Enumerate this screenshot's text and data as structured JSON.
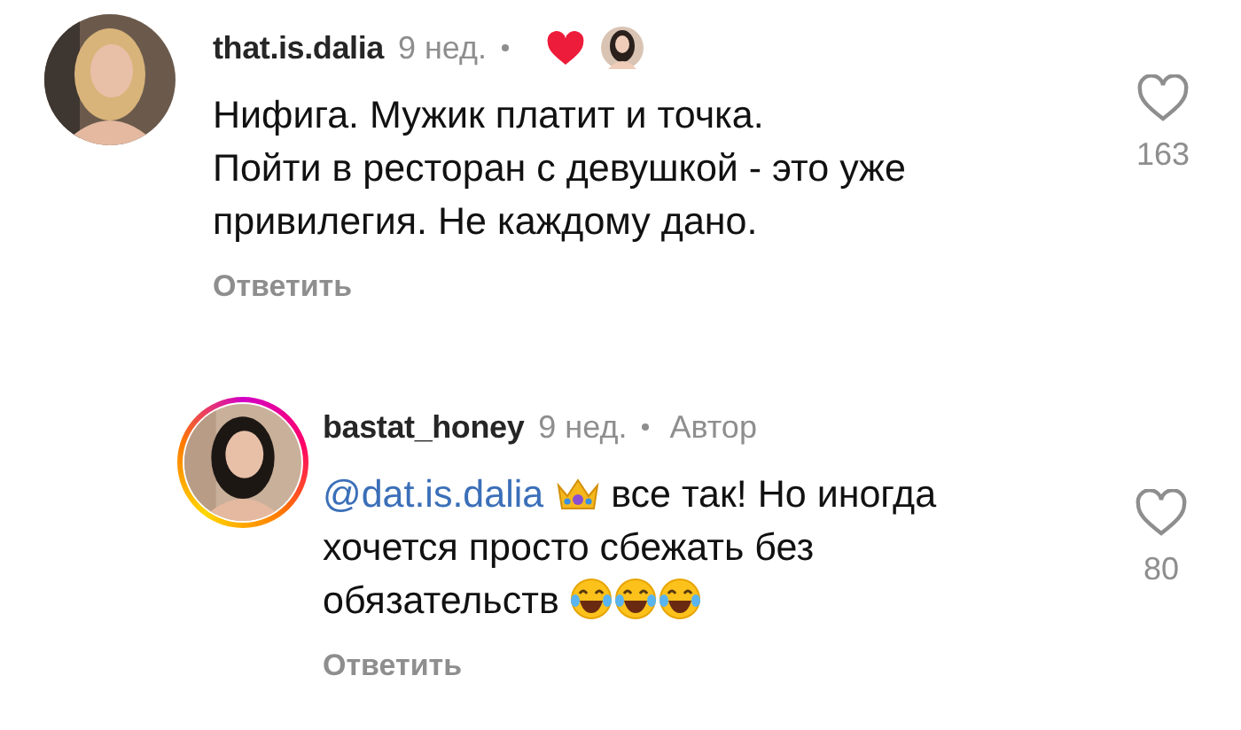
{
  "comments": [
    {
      "username": "that.is.dalia",
      "time": "9 нед.",
      "story_ring": false,
      "liked_by_author": true,
      "reply_offset": false,
      "body": [
        {
          "kind": "text",
          "text": "Нифига. Мужик платит и точка.\nПойти в ресторан с девушкой - это уже привилегия. Не каждому дано."
        }
      ],
      "liked": false,
      "likes": "163",
      "reply": "Ответить"
    },
    {
      "username": "bastat_honey",
      "time": "9 нед.",
      "story_ring": true,
      "liked_by_author": false,
      "badge": "Автор",
      "reply_offset": true,
      "body": [
        {
          "kind": "mention",
          "text": "@dat.is.dalia"
        },
        {
          "kind": "crown"
        },
        {
          "kind": "text",
          "text": "все так! Но иногда хочется просто сбежать без обязательств"
        },
        {
          "kind": "laugh"
        },
        {
          "kind": "laugh"
        },
        {
          "kind": "laugh"
        }
      ],
      "liked": false,
      "likes": "80",
      "reply": "Ответить"
    }
  ]
}
